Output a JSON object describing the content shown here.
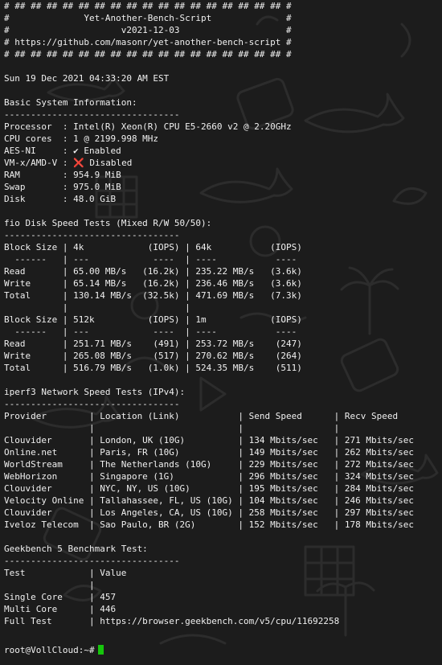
{
  "terminal": {
    "lines": [
      "# ## ## ## ## ## ## ## ## ## ## ## ## ## ## ## ## ## #",
      "#              Yet-Another-Bench-Script              #",
      "#                     v2021-12-03                    #",
      "# https://github.com/masonr/yet-another-bench-script #",
      "# ## ## ## ## ## ## ## ## ## ## ## ## ## ## ## ## ## #",
      "",
      "Sun 19 Dec 2021 04:33:20 AM EST",
      "",
      "Basic System Information:",
      "---------------------------------",
      "Processor  : Intel(R) Xeon(R) CPU E5-2660 v2 @ 2.20GHz",
      "CPU cores  : 1 @ 2199.998 MHz",
      "AES-NI     : ✔ Enabled",
      "VM-x/AMD-V : ❌ Disabled",
      "RAM        : 954.9 MiB",
      "Swap       : 975.0 MiB",
      "Disk       : 48.0 GiB",
      "",
      "fio Disk Speed Tests (Mixed R/W 50/50):",
      "---------------------------------",
      "Block Size | 4k            (IOPS) | 64k           (IOPS)",
      "  ------   | ---            ----  | ----           ----",
      "Read       | 65.00 MB/s   (16.2k) | 235.22 MB/s   (3.6k)",
      "Write      | 65.14 MB/s   (16.2k) | 236.46 MB/s   (3.6k)",
      "Total      | 130.14 MB/s  (32.5k) | 471.69 MB/s   (7.3k)",
      "           |                      |",
      "Block Size | 512k          (IOPS) | 1m            (IOPS)",
      "  ------   | ---            ----  | ----           ----",
      "Read       | 251.71 MB/s    (491) | 253.72 MB/s    (247)",
      "Write      | 265.08 MB/s    (517) | 270.62 MB/s    (264)",
      "Total      | 516.79 MB/s   (1.0k) | 524.35 MB/s    (511)",
      "",
      "iperf3 Network Speed Tests (IPv4):",
      "---------------------------------",
      "Provider        | Location (Link)           | Send Speed      | Recv Speed",
      "                |                           |                 |",
      "Clouvider       | London, UK (10G)          | 134 Mbits/sec   | 271 Mbits/sec",
      "Online.net      | Paris, FR (10G)           | 149 Mbits/sec   | 262 Mbits/sec",
      "WorldStream     | The Netherlands (10G)     | 229 Mbits/sec   | 272 Mbits/sec",
      "WebHorizon      | Singapore (1G)            | 296 Mbits/sec   | 324 Mbits/sec",
      "Clouvider       | NYC, NY, US (10G)         | 195 Mbits/sec   | 284 Mbits/sec",
      "Velocity Online | Tallahassee, FL, US (10G) | 104 Mbits/sec   | 246 Mbits/sec",
      "Clouvider       | Los Angeles, CA, US (10G) | 258 Mbits/sec   | 297 Mbits/sec",
      "Iveloz Telecom  | Sao Paulo, BR (2G)        | 152 Mbits/sec   | 178 Mbits/sec",
      "",
      "Geekbench 5 Benchmark Test:",
      "---------------------------------",
      "Test            | Value",
      "                |",
      "Single Core     | 457",
      "Multi Core      | 446",
      "Full Test       | https://browser.geekbench.com/v5/cpu/11692258",
      ""
    ],
    "prompt": "root@VollCloud:~#",
    "colors": {
      "background": "#1c1c1c",
      "text": "#f0f0f0",
      "cursor": "#16c60c",
      "doodle": "#2a2a2a"
    },
    "background_pattern": "shark-doodle-wallpaper"
  }
}
